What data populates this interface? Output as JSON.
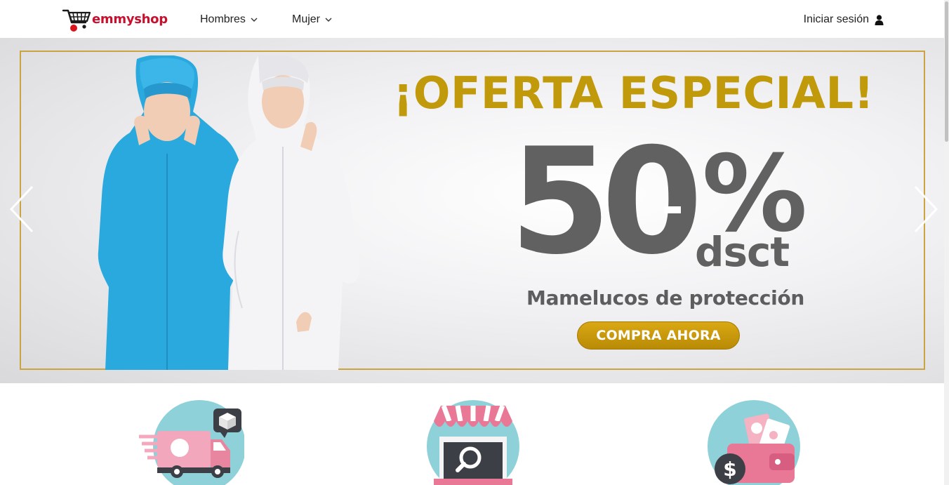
{
  "brand": {
    "name": "emmyshop",
    "color": "#c8102e"
  },
  "nav": {
    "items": [
      {
        "label": "Hombres"
      },
      {
        "label": "Mujer"
      }
    ],
    "login_label": "Iniciar sesión"
  },
  "hero": {
    "title": "¡OFERTA ESPECIAL!",
    "discount_number": "50",
    "discount_sign": "%",
    "discount_suffix": "dsct",
    "subtitle": "Mamelucos de protección",
    "cta_label": "COMPRA AHORA",
    "accent_color": "#c19a0b",
    "text_color": "#616161"
  },
  "features": [
    {
      "icon": "delivery-truck-icon"
    },
    {
      "icon": "store-search-icon"
    },
    {
      "icon": "wallet-money-icon"
    }
  ]
}
